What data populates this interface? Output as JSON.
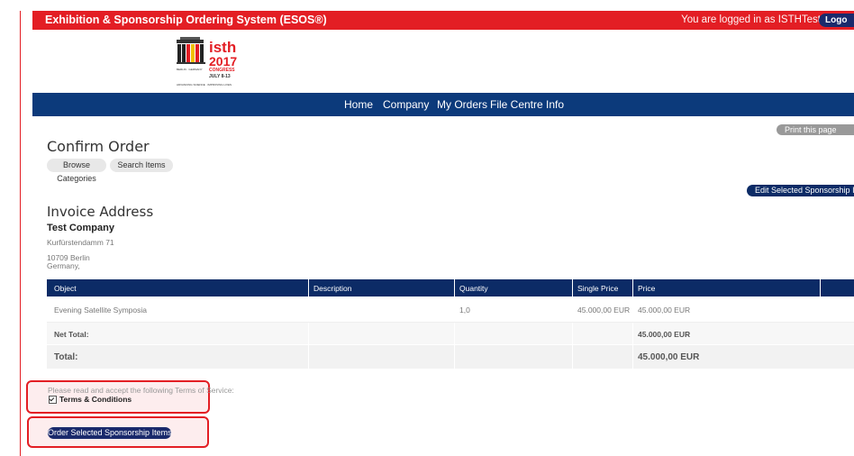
{
  "topbar": {
    "title": "Exhibition & Sponsorship Ordering System (ESOS®)",
    "login_text": "You are logged in as ISTHTest",
    "logout_label": "Logo"
  },
  "logo": {
    "word_top": "isth",
    "year": "2017",
    "congress": "CONGRESS",
    "dates": "JULY 8-13",
    "city": "BERLIN · GERMANY",
    "tagline": "ADVANCING SCIENCE · IMPROVING LIVES"
  },
  "nav": [
    "Home",
    "Company",
    "My Orders",
    "File Centre",
    "Info"
  ],
  "print_label": "Print this page",
  "page_title": "Confirm Order",
  "buttons": {
    "browse": "Browse Categories",
    "search": "Search Items",
    "edit": "Edit Selected Sponsorship Items",
    "order": "Order Selected Sponsorship Items"
  },
  "invoice": {
    "heading": "Invoice Address",
    "company": "Test Company",
    "street": "Kurfürstendamm 71",
    "zip_city": "10709 Berlin",
    "country": "Germany,"
  },
  "table": {
    "headers": [
      "Object",
      "Description",
      "Quantity",
      "Single Price",
      "Price"
    ],
    "rows": [
      {
        "object": "Evening Satellite Symposia",
        "description": "",
        "quantity": "1,0",
        "single_price": "45.000,00 EUR",
        "price": "45.000,00 EUR"
      }
    ],
    "net_total_label": "Net Total:",
    "net_total_value": "45.000,00 EUR",
    "total_label": "Total:",
    "total_value": "45.000,00 EUR"
  },
  "terms": {
    "question": "Please read and accept the following Terms of Service:",
    "link": "Terms & Conditions",
    "checked": true
  },
  "colors": {
    "brand_red": "#e31e24",
    "nav_blue": "#0c3a7b",
    "dark_blue": "#0c2b66"
  }
}
